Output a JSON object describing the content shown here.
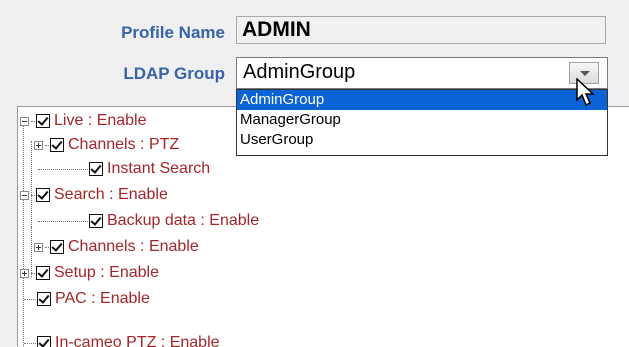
{
  "form": {
    "profile_name_label": "Profile Name",
    "profile_name_value": "ADMIN",
    "ldap_group_label": "LDAP Group",
    "ldap_group_value": "AdminGroup"
  },
  "dropdown": {
    "options": [
      "AdminGroup",
      "ManagerGroup",
      "UserGroup"
    ],
    "selected_index": 0
  },
  "tree": {
    "nodes": [
      {
        "label": "Live : Enable",
        "checked": true,
        "expander": "expanded"
      },
      {
        "label": "Channels : PTZ",
        "checked": true,
        "expander": "collapsed"
      },
      {
        "label": "Instant Search",
        "checked": true,
        "expander": "none"
      },
      {
        "label": "Search : Enable",
        "checked": true,
        "expander": "expanded"
      },
      {
        "label": "Backup data : Enable",
        "checked": true,
        "expander": "none"
      },
      {
        "label": "Channels : Enable",
        "checked": true,
        "expander": "collapsed"
      },
      {
        "label": "Setup : Enable",
        "checked": true,
        "expander": "collapsed"
      },
      {
        "label": "PAC : Enable",
        "checked": true,
        "expander": "none"
      },
      {
        "label": "In-cameo PTZ : Enable",
        "checked": true,
        "expander": "none"
      }
    ]
  }
}
